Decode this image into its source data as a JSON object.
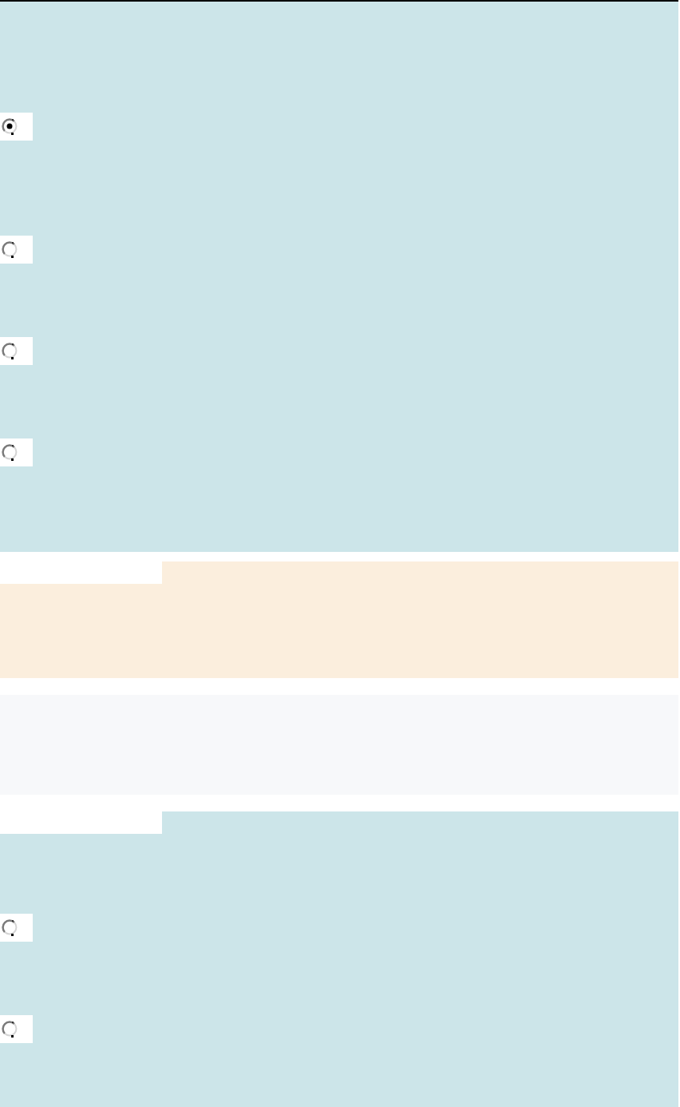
{
  "sections": [
    {
      "kind": "choices",
      "notched": false,
      "options": [
        {
          "selected": true
        },
        {
          "selected": false
        },
        {
          "selected": false
        },
        {
          "selected": false
        }
      ]
    },
    {
      "kind": "note",
      "notched": true
    },
    {
      "kind": "plain"
    },
    {
      "kind": "choices",
      "notched": true,
      "options": [
        {
          "selected": false
        },
        {
          "selected": false
        }
      ]
    }
  ]
}
